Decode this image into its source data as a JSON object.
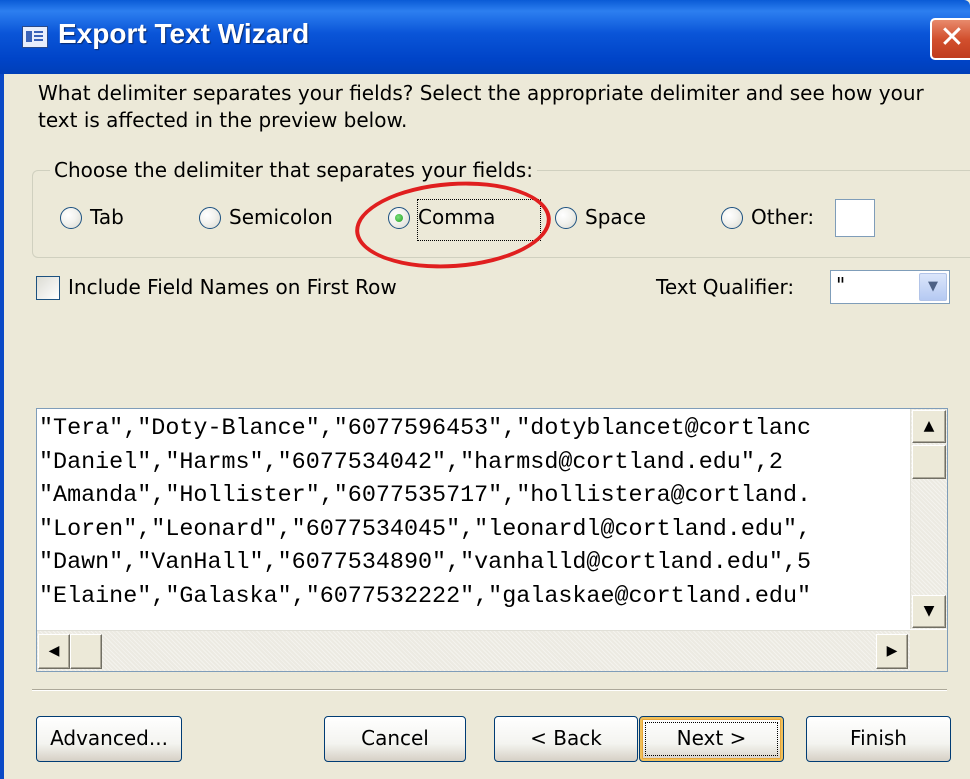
{
  "window": {
    "title": "Export Text Wizard",
    "close_glyph": "✕"
  },
  "instructions": "What delimiter separates your fields? Select the appropriate delimiter and see how your text is affected in the preview below.",
  "delimiter_group": {
    "caption": "Choose the delimiter that separates your fields:",
    "options": [
      {
        "label": "Tab",
        "checked": false
      },
      {
        "label": "Semicolon",
        "checked": false
      },
      {
        "label": "Comma",
        "checked": true
      },
      {
        "label": "Space",
        "checked": false
      },
      {
        "label": "Other:",
        "checked": false
      }
    ],
    "other_value": ""
  },
  "include_field_names": {
    "label": "Include Field Names on First Row",
    "checked": false
  },
  "text_qualifier": {
    "label": "Text Qualifier:",
    "value": "\""
  },
  "preview": {
    "lines": [
      "\"Tera\",\"Doty-Blance\",\"6077596453\",\"dotyblancet@cortlanc",
      "\"Daniel\",\"Harms\",\"6077534042\",\"harmsd@cortland.edu\",2",
      "\"Amanda\",\"Hollister\",\"6077535717\",\"hollistera@cortland.",
      "\"Loren\",\"Leonard\",\"6077534045\",\"leonardl@cortland.edu\",",
      "\"Dawn\",\"VanHall\",\"6077534890\",\"vanhalld@cortland.edu\",5",
      "\"Elaine\",\"Galaska\",\"6077532222\",\"galaskae@cortland.edu\""
    ]
  },
  "buttons": {
    "advanced": "Advanced...",
    "cancel": "Cancel",
    "back": "< Back",
    "next": "Next >",
    "finish": "Finish"
  },
  "colors": {
    "title_bar": "#0a55d8",
    "close_button": "#d2502e",
    "dialog_bg": "#ece9d8",
    "highlight_annotation": "#e01f1f"
  },
  "icons": [
    "wizard-window-icon",
    "close-icon",
    "scroll-up-icon",
    "scroll-down-icon",
    "scroll-left-icon",
    "scroll-right-icon",
    "dropdown-arrow-icon"
  ]
}
